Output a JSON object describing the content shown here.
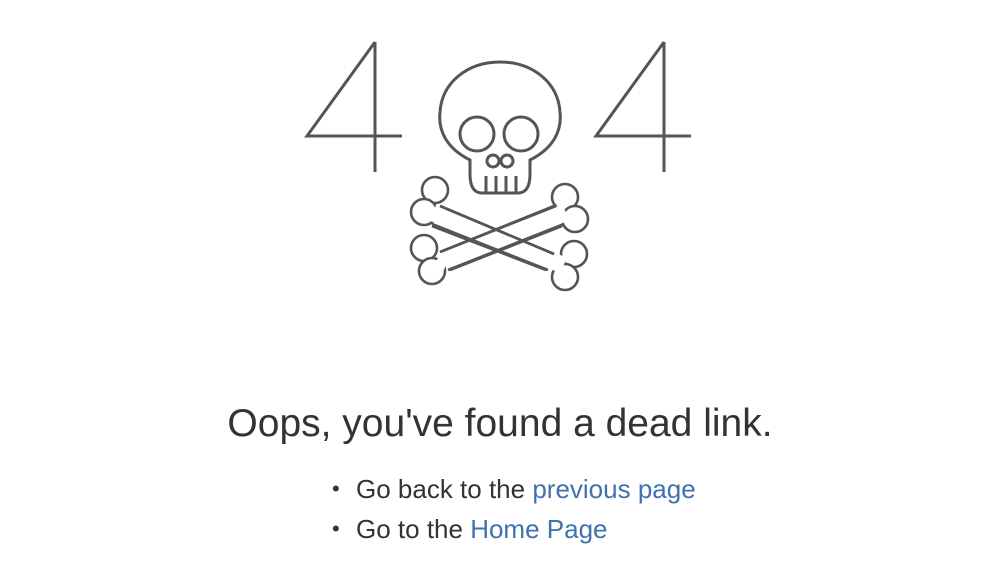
{
  "illustration": {
    "left_digit": "4",
    "right_digit": "4",
    "stroke_color": "#555555",
    "icon": "skull-and-crossbones-icon"
  },
  "message": {
    "headline": "Oops, you've found a dead link."
  },
  "links": [
    {
      "prefix": "Go back to the ",
      "link_text": "previous page"
    },
    {
      "prefix": "Go to the ",
      "link_text": "Home Page"
    }
  ],
  "colors": {
    "text": "#333333",
    "link": "#3f72af"
  }
}
